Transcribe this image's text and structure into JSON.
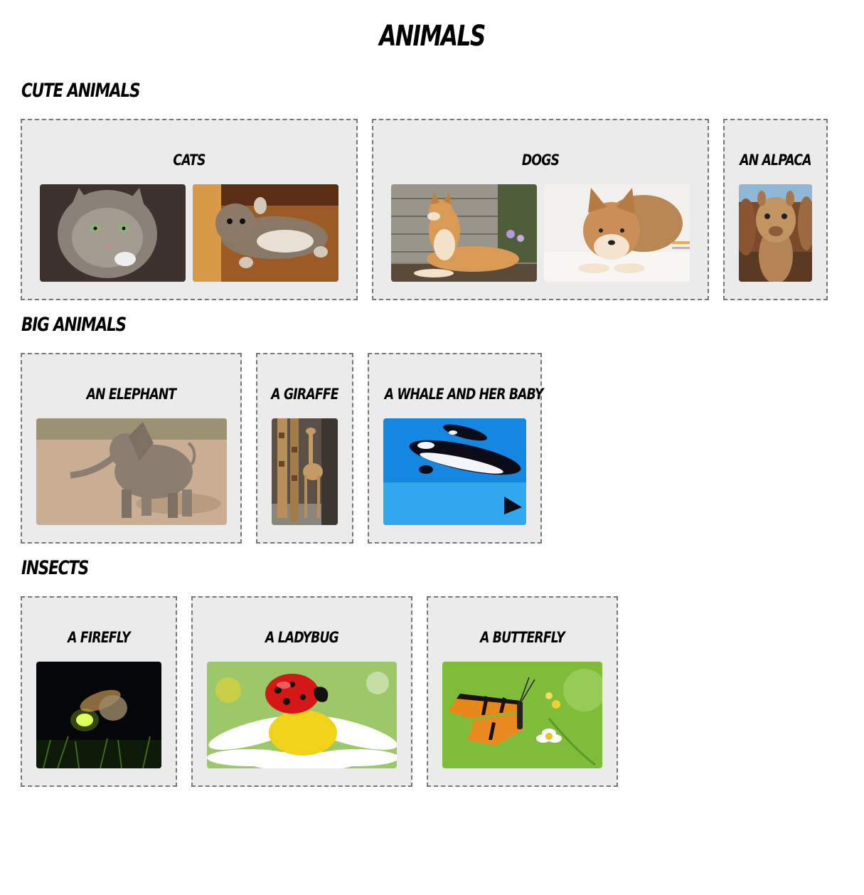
{
  "page": {
    "title": "Animals"
  },
  "sections": [
    {
      "title": "Cute Animals",
      "cards": [
        {
          "title": "Cats",
          "images": [
            "cat-photo",
            "kitten-photo"
          ]
        },
        {
          "title": "Dogs",
          "images": [
            "shiba-lying-photo",
            "shiba-resting-photo"
          ]
        },
        {
          "title": "An Alpaca",
          "images": [
            "alpaca-photo"
          ]
        }
      ]
    },
    {
      "title": "Big Animals",
      "cards": [
        {
          "title": "An Elephant",
          "images": [
            "elephant-photo"
          ]
        },
        {
          "title": "A Giraffe",
          "images": [
            "giraffe-photo"
          ]
        },
        {
          "title": "A Whale and her baby",
          "images": [
            "orca-photo"
          ]
        }
      ]
    },
    {
      "title": "Insects",
      "cards": [
        {
          "title": "A Firefly",
          "images": [
            "firefly-photo"
          ]
        },
        {
          "title": "A Ladybug",
          "images": [
            "ladybug-photo"
          ]
        },
        {
          "title": "A Butterfly",
          "images": [
            "butterfly-photo"
          ]
        }
      ]
    }
  ]
}
